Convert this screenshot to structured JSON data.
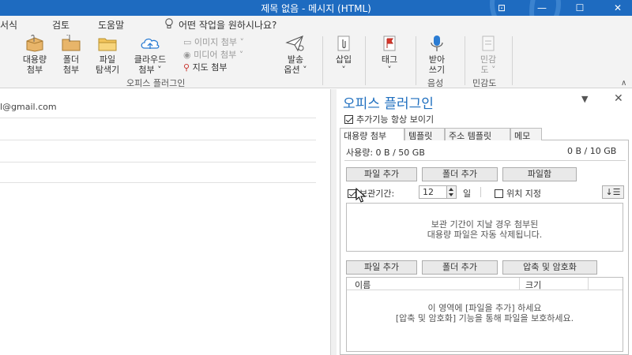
{
  "window": {
    "title": "제목 없음  -  메시지 (HTML)",
    "controls": [
      "⊡",
      "—",
      "☐",
      "✕"
    ]
  },
  "tabs": {
    "items": [
      "서식",
      "검토",
      "도움말"
    ],
    "tell_me": "어떤 작업을 원하시나요?"
  },
  "ribbon": {
    "large_attach": "대용량\n첨부",
    "folder_attach": "폴더\n첨부",
    "file_explorer": "파일\n탐색기",
    "cloud_attach": "클라우드\n첨부 ˅",
    "image_attach": "이미지 첨부 ˅",
    "media_attach": "미디어 첨부 ˅",
    "map_attach": "지도 첨부",
    "send_options": "발송\n옵션 ˅",
    "insert": "삽입\n˅",
    "tag": "태그\n˅",
    "dictate": "받아\n쓰기",
    "sensitivity": "민감\n도 ˅",
    "group_office": "오피스 플러그인",
    "group_voice": "음성",
    "group_sens": "민감도"
  },
  "mail": {
    "to_value": "l@gmail.com"
  },
  "pane": {
    "title": "오피스 플러그인",
    "menu_glyph": "▼",
    "close_glyph": "✕",
    "always_show": "추가기능 항상 보이기",
    "tabs": [
      "대용량 첨부",
      "템플릿",
      "주소 템플릿",
      "메모"
    ],
    "usage_label": "사용량: 0 B / 50 GB",
    "usage_right": "0 B / 10 GB",
    "add_file": "파일 추가",
    "add_folder": "폴더 추가",
    "file_box": "파일함",
    "keep_label": "보관기간:",
    "keep_days": "12",
    "day_unit": "일",
    "location": "위치 지정",
    "sort_glyph": "↓☰",
    "notice_line1": "보관 기간이 지날 경우 첨부된",
    "notice_line2": "대용량 파일은 자동 삭제됩니다.",
    "add_file2": "파일 추가",
    "add_folder2": "폴더 추가",
    "compress": "압축 및 암호화",
    "col_name": "이름",
    "col_size": "크기",
    "empty_line1": "이 영역에 [파일을 추가] 하세요",
    "empty_line2": "[압축 및 암호화] 기능을 통해 파일을 보호하세요."
  }
}
